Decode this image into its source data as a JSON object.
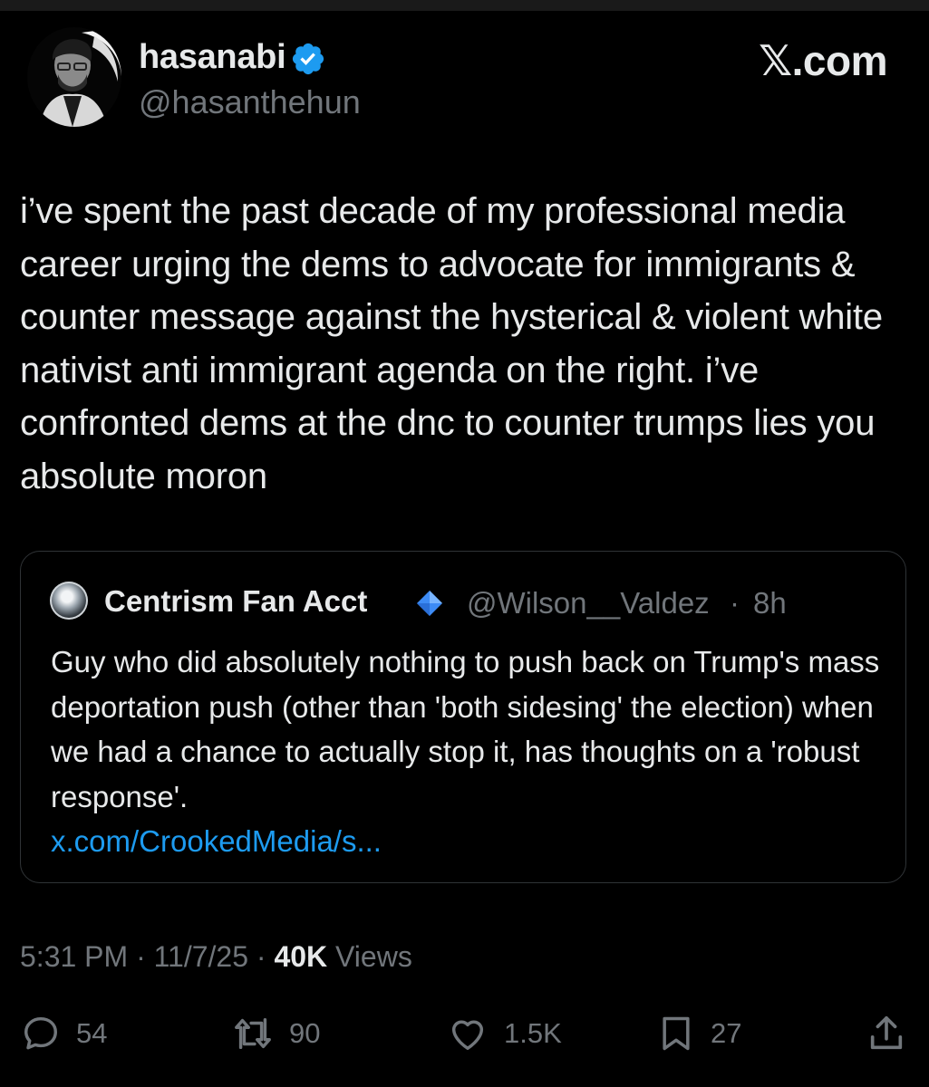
{
  "post": {
    "author_name": "hasanabi",
    "handle": "@hasanthehun",
    "brand": "𝕏.com",
    "body": "i’ve spent the past decade of my professional media career urging the dems to advocate for immigrants & counter message against the hysterical & violent white nativist anti immigrant agenda on the right. i’ve confronted dems at the dnc to counter trumps lies you absolute moron",
    "time": "5:31 PM",
    "date": "11/7/25",
    "views_count": "40K",
    "views_label": "Views"
  },
  "quote": {
    "author_name": "Centrism Fan Acct",
    "handle": "@Wilson__Valdez",
    "time": "8h",
    "text": "Guy who did absolutely nothing to push back on Trump's mass deportation push (other than 'both sidesing' the election) when we had a chance to actually stop it, has thoughts on a 'robust response'.",
    "link": "x.com/CrookedMedia/s..."
  },
  "actions": {
    "replies": "54",
    "reposts": "90",
    "likes": "1.5K",
    "bookmarks": "27"
  },
  "colors": {
    "background": "#000000",
    "text": "#e7e9ea",
    "muted": "#71767b",
    "link": "#1d9bf0",
    "verified": "#1d9bf0",
    "border": "#2f3336"
  },
  "icons": {
    "verified": "verified-badge-icon",
    "quote_badge": "blue-diamond-icon",
    "reply": "speech-bubble-icon",
    "repost": "repost-arrows-icon",
    "like": "heart-icon",
    "bookmark": "bookmark-icon",
    "share": "share-upload-icon"
  }
}
